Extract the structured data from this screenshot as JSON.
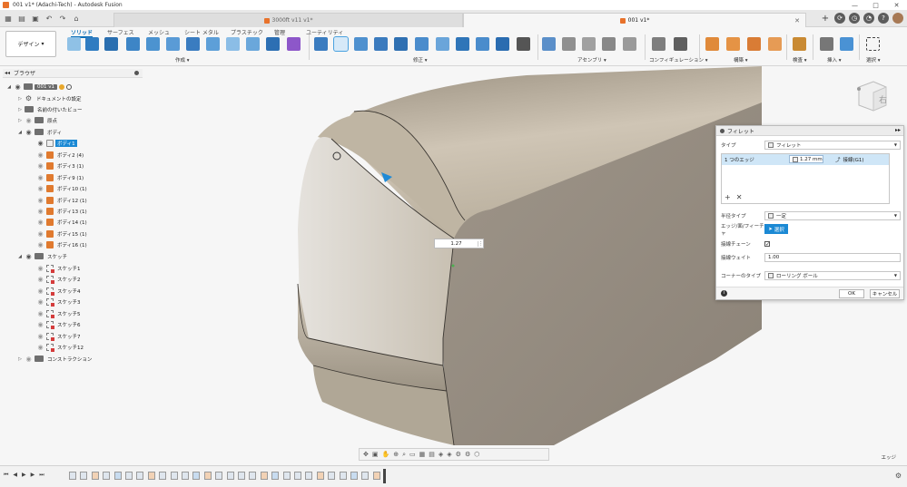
{
  "title": "001 v1* (Adachi-Tech) - Autodesk Fusion",
  "window_controls": [
    "—",
    "□",
    "✕"
  ],
  "tabs": [
    {
      "label": "3000ft v11 v1*",
      "active": false
    },
    {
      "label": "001 v1*",
      "active": true
    }
  ],
  "toolbar": {
    "workspace": "デザイン",
    "workspace_arrow": "▾",
    "menu_tabs": [
      "ソリッド",
      "サーフェス",
      "メッシュ",
      "シート メタル",
      "プラスチック",
      "管理",
      "ユーティリティ"
    ],
    "groups": [
      {
        "label": "作成 ▾"
      },
      {
        "label": "修正 ▾"
      },
      {
        "label": "アセンブリ ▾"
      },
      {
        "label": "コンフィギュレーション ▾"
      },
      {
        "label": "構築 ▾"
      },
      {
        "label": "検査 ▾"
      },
      {
        "label": "挿入 ▾"
      },
      {
        "label": "選択 ▾"
      }
    ]
  },
  "browser": {
    "title": "ブラウザ",
    "collapse": "◂◂",
    "root": "001 v1",
    "items": [
      "ドキュメントの設定",
      "名前の付いたビュー",
      "原点",
      "ボディ"
    ],
    "bodies": [
      "ボディ1",
      "ボディ2 (4)",
      "ボディ3 (1)",
      "ボディ9 (1)",
      "ボディ10 (1)",
      "ボディ12 (1)",
      "ボディ13 (1)",
      "ボディ14 (1)",
      "ボディ15 (1)",
      "ボディ16 (1)"
    ],
    "sketch_folder": "スケッチ",
    "sketches": [
      "スケッチ1",
      "スケッチ2",
      "スケッチ4",
      "スケッチ3",
      "スケッチ5",
      "スケッチ6",
      "スケッチ7",
      "スケッチ12"
    ],
    "construction": "コンストラクション"
  },
  "viewcube": {
    "face": "右"
  },
  "dimension": {
    "value": "1.27"
  },
  "dialog": {
    "title": "フィレット",
    "expand": "▸▸",
    "type_label": "タイプ",
    "type_value": "フィレット",
    "edge_label": "1 つのエッジ",
    "edge_value": "1.27 mm",
    "tangent": "接線(G1)",
    "add": "+",
    "remove": "✕",
    "radius_type_label": "半径タイプ",
    "radius_type_value": "一定",
    "edge_face_label": "エッジ/面/フィーチャ",
    "select": "選択",
    "tangent_chain_label": "接線チェーン",
    "tangent_chain_checked": "✓",
    "tangent_weight_label": "接線ウェイト",
    "tangent_weight_value": "1.00",
    "corner_type_label": "コーナーのタイプ",
    "corner_type_value": "ローリング ボール",
    "ok": "OK",
    "cancel": "キャンセル"
  },
  "status_text": "エッジ",
  "timeline": {
    "controls": [
      "⏮",
      "◀",
      "▶",
      "▶",
      "⏭"
    ],
    "gear": "⚙",
    "count": 28
  }
}
